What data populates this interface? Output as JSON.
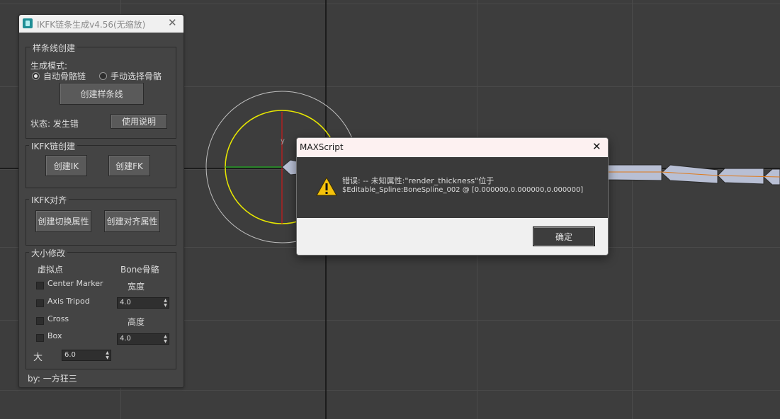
{
  "panel": {
    "title": "IKFK链条生成v4.56(无缩放)",
    "close_glyph": "✕",
    "spline_group": {
      "title": "样条线创建",
      "mode_label": "生成模式:",
      "radio_auto": "自动骨骼链",
      "radio_manual": "手动选择骨骼",
      "selected_mode": "自动骨骼链",
      "create_spline_button": "创建样条线",
      "status": "状态: 发生错",
      "help_button": "使用说明"
    },
    "ikfk_group": {
      "title": "IKFK链创建",
      "create_ik_button": "创建IK",
      "create_fk_button": "创建FK"
    },
    "align_group": {
      "title": "IKFK对齐",
      "switch_button": "创建切换属性",
      "align_button": "创建对齐属性"
    },
    "size_group": {
      "title": "大小修改",
      "dummy_header": "虚拟点",
      "bone_header": "Bone骨骼",
      "options": [
        "Center Marker",
        "Axis Tripod",
        "Cross",
        "Box"
      ],
      "width_label": "宽度",
      "width_value": "4.0",
      "height_label": "高度",
      "height_value": "4.0",
      "size_label": "大",
      "size_value": "6.0"
    },
    "footer": "by: 一方狂三"
  },
  "dialog": {
    "title": "MAXScript",
    "close_glyph": "✕",
    "message_line1": "错误: -- 未知属性:\"render_thickness\"位于",
    "message_line2": "$Editable_Spline:BoneSpline_002 @ [0.000000,0.000000,0.000000]",
    "ok_button": "确定",
    "icon": "warning-icon"
  },
  "viewport": {
    "axis_label": "y",
    "background": "#3d3d3d",
    "gizmo_color": "#e8e800"
  }
}
